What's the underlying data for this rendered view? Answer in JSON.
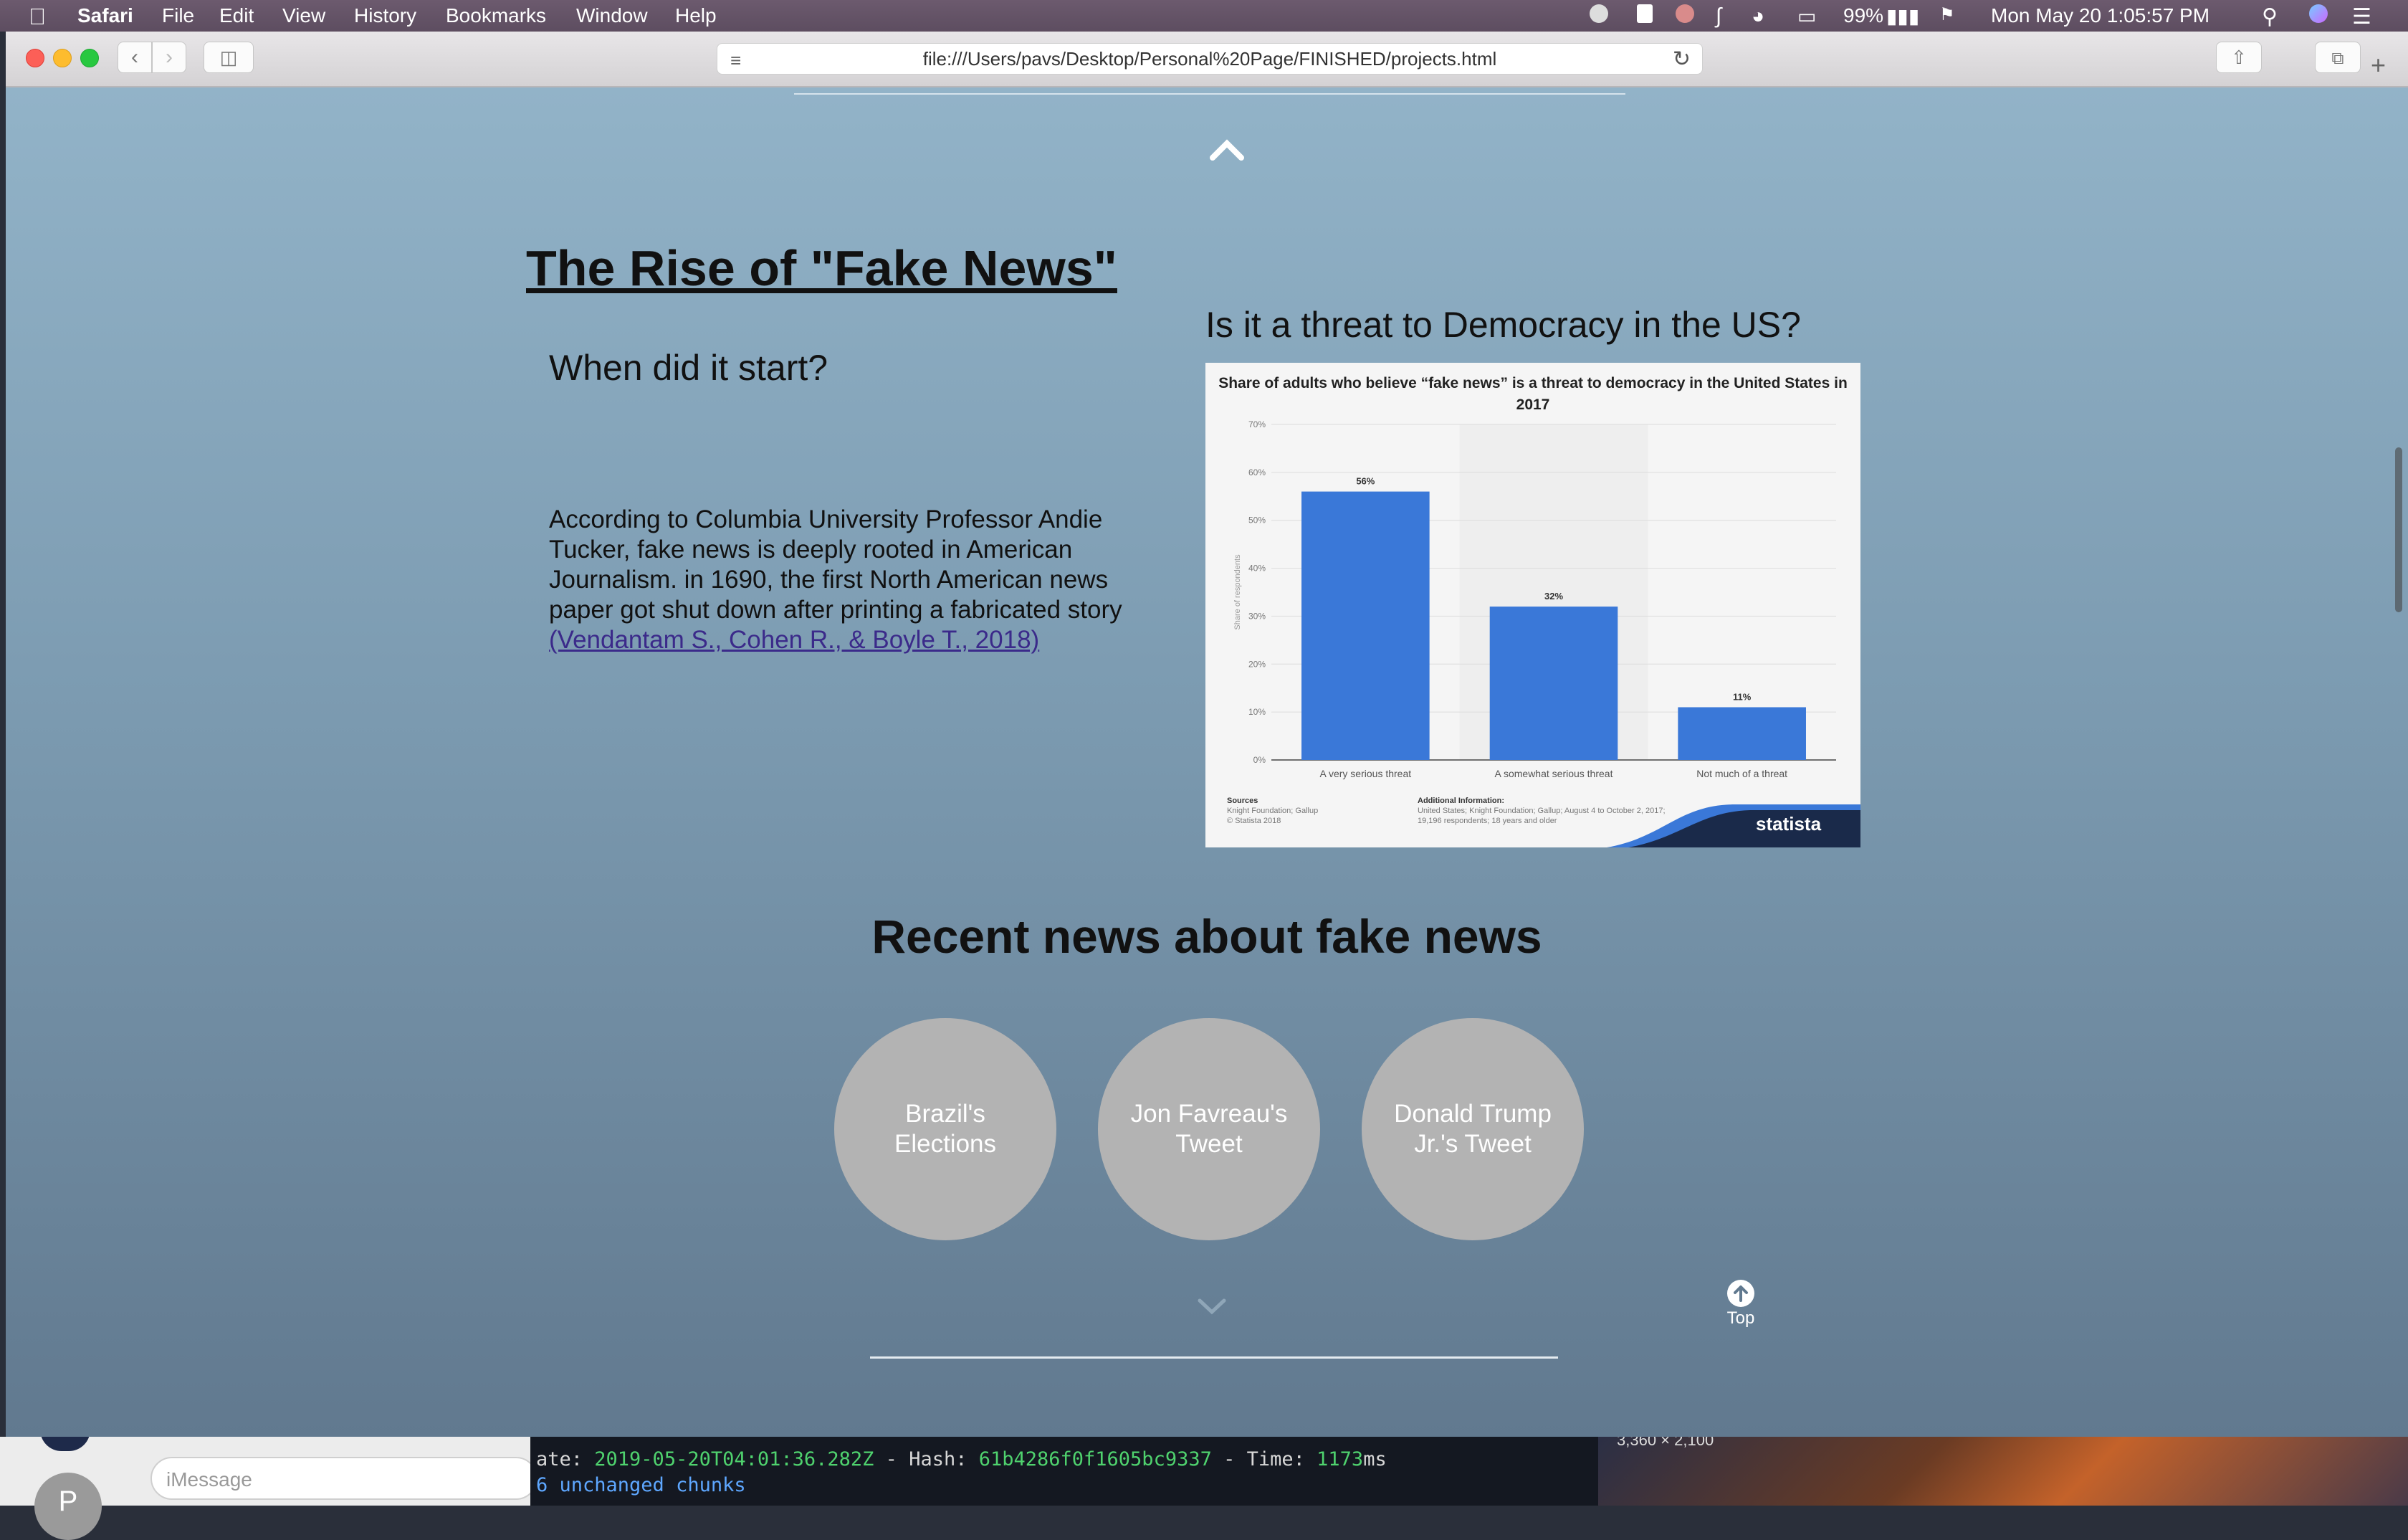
{
  "menubar": {
    "app_name": "Safari",
    "menus": [
      "File",
      "Edit",
      "View",
      "History",
      "Bookmarks",
      "Window",
      "Help"
    ],
    "battery": "99%",
    "clock": "Mon May 20  1:05:57 PM"
  },
  "browser": {
    "url": "file:///Users/pavs/Desktop/Personal%20Page/FINISHED/projects.html"
  },
  "page": {
    "title": "The Rise of \"Fake News\"",
    "when_heading": "When did it start?",
    "history_text": "According to Columbia University Professor Andie Tucker, fake news is deeply rooted in American Journalism. in 1690, the first North American news paper got shut down after printing a fabricated story ",
    "citation": "(Vendantam S., Cohen R., & Boyle T., 2018)",
    "threat_heading": "Is it a threat to Democracy in the US?",
    "recent_heading": "Recent news about fake news",
    "news_buttons": [
      "Brazil's Elections",
      "Jon Favreau's Tweet",
      "Donald Trump Jr.'s Tweet"
    ],
    "top_label": "Top"
  },
  "chart_data": {
    "type": "bar",
    "title": "Share of adults who believe “fake news” is a threat to democracy in the United States in 2017",
    "categories": [
      "A very serious threat",
      "A somewhat serious threat",
      "Not much of a threat"
    ],
    "values": [
      56,
      32,
      11
    ],
    "value_labels": [
      "56%",
      "32%",
      "11%"
    ],
    "ylabel": "Share of respondents",
    "ylim": [
      0,
      70
    ],
    "yticks": [
      "0%",
      "10%",
      "20%",
      "30%",
      "40%",
      "50%",
      "60%",
      "70%"
    ],
    "grid": true,
    "bar_color": "#3a78d8",
    "sources_heading": "Sources",
    "sources": [
      "Knight Foundation; Gallup",
      "© Statista 2018"
    ],
    "additional_heading": "Additional Information:",
    "additional": "United States; Knight Foundation; Gallup; August 4 to October 2, 2017; 19,196 respondents; 18 years and older",
    "brand": "statista"
  },
  "desktop": {
    "imessage_placeholder": "iMessage",
    "avatar_initial": "P",
    "terminal_line1_prefix": "ate: ",
    "terminal_line1_date": "2019-05-20T04:01:36.282Z",
    "terminal_line1_mid": " - Hash: ",
    "terminal_line1_hash": "61b4286f0f1605bc9337",
    "terminal_line1_time_label": " - Time: ",
    "terminal_line1_time": "1173",
    "terminal_line1_unit": "ms",
    "terminal_line2": "6 unchanged chunks",
    "wallpaper_label": "3,360 × 2,100"
  },
  "colors": {
    "page_top": "#92b3c8",
    "page_bottom": "#61798f",
    "circle": "#b3b3b3",
    "link": "#3b2a8a"
  }
}
